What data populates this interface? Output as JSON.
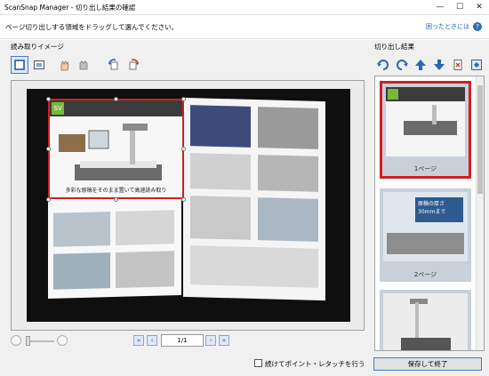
{
  "window": {
    "title": "ScanSnap Manager - 切り出し結果の確認",
    "minimize": "—",
    "maximize": "☐",
    "close": "✕"
  },
  "instruction": {
    "text": "ページ切り出しする領域をドラッグして選んでください。",
    "help_link": "困ったときには",
    "help_icon": "?"
  },
  "left_panel": {
    "label": "読み取りイメージ",
    "tools": [
      {
        "name": "select-area-icon",
        "selected": true
      },
      {
        "name": "crop-image-icon",
        "selected": false
      },
      {
        "name": "hand-tool-icon",
        "selected": false
      },
      {
        "name": "hand-pan-icon",
        "selected": false
      },
      {
        "name": "rotate-left-icon",
        "selected": false
      },
      {
        "name": "rotate-right-icon",
        "selected": false
      }
    ],
    "crop_caption": "多彩な原稿をそのまま置いて高速読み取り",
    "badge": "SV"
  },
  "navigation": {
    "page": "1/1"
  },
  "options": {
    "continue_label": "続けてポイント・レタッチを行う",
    "continue_checked": false
  },
  "right_panel": {
    "label": "切り出し結果",
    "thumbnails": [
      {
        "label": "1ページ",
        "selected": true
      },
      {
        "label": "2ページ",
        "selected": false
      },
      {
        "label": "",
        "selected": false
      }
    ],
    "thumb2_text": "原稿の厚さ30mmまで",
    "save_button": "保存して終了"
  },
  "colors": {
    "accent": "#3c7fd0",
    "crop_red": "#d02020",
    "logo_green": "#7ab83a"
  }
}
